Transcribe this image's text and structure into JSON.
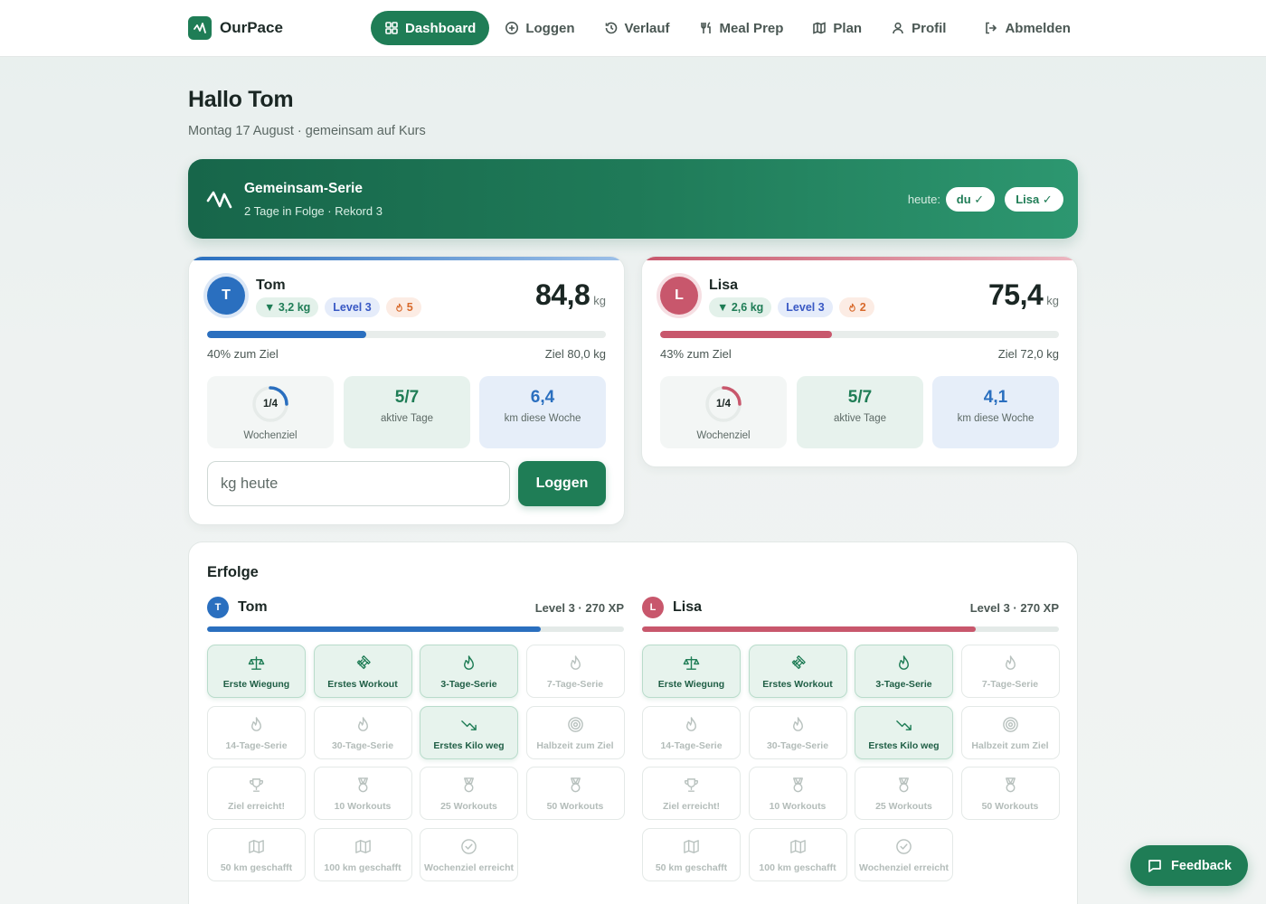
{
  "app": {
    "name": "OurPace"
  },
  "nav": {
    "items": [
      {
        "label": "Dashboard",
        "icon": "grid-icon",
        "active": true
      },
      {
        "label": "Loggen",
        "icon": "plus-circle-icon"
      },
      {
        "label": "Verlauf",
        "icon": "history-icon"
      },
      {
        "label": "Meal Prep",
        "icon": "fork-knife-icon"
      },
      {
        "label": "Plan",
        "icon": "map-icon"
      },
      {
        "label": "Profil",
        "icon": "user-icon"
      },
      {
        "label": "Abmelden",
        "icon": "logout-icon"
      }
    ]
  },
  "header": {
    "greeting": "Hallo Tom",
    "subline": "Montag 17 August · gemeinsam auf Kurs"
  },
  "streak": {
    "title": "Gemeinsam-Serie",
    "subtitle": "2 Tage in Folge · Rekord 3",
    "today_label": "heute:",
    "pill_you": "du ✓",
    "pill_partner": "Lisa ✓"
  },
  "people": [
    {
      "initial": "T",
      "name": "Tom",
      "color": "#2a6fbf",
      "ring_bg": "#dbe7f6",
      "loss": "▼ 3,2 kg",
      "level": "Level 3",
      "streak": "5",
      "weight": "84,8",
      "unit": "kg",
      "progress_pct": 40,
      "progress_label": "40% zum Ziel",
      "goal_label": "Ziel 80,0 kg",
      "week_goal": "1/4",
      "week_goal_fraction": 0.25,
      "week_goal_label": "Wochenziel",
      "active_days": "5/7",
      "active_days_label": "aktive Tage",
      "km": "6,4",
      "km_label": "km diese Woche",
      "input_placeholder": "kg heute",
      "log_button": "Loggen"
    },
    {
      "initial": "L",
      "name": "Lisa",
      "color": "#c8576c",
      "ring_bg": "#f6dfe3",
      "loss": "▼ 2,6 kg",
      "level": "Level 3",
      "streak": "2",
      "weight": "75,4",
      "unit": "kg",
      "progress_pct": 43,
      "progress_label": "43% zum Ziel",
      "goal_label": "Ziel 72,0 kg",
      "week_goal": "1/4",
      "week_goal_fraction": 0.25,
      "week_goal_label": "Wochenziel",
      "active_days": "5/7",
      "active_days_label": "aktive Tage",
      "km": "4,1",
      "km_label": "km diese Woche"
    }
  ],
  "achievements": {
    "title": "Erfolge",
    "players": [
      {
        "initial": "T",
        "name": "Tom",
        "level_xp": "Level 3 · 270 XP",
        "xp_pct": 80,
        "color": "#2a6fbf"
      },
      {
        "initial": "L",
        "name": "Lisa",
        "level_xp": "Level 3 · 270 XP",
        "xp_pct": 80,
        "color": "#c8576c"
      }
    ],
    "items": [
      {
        "label": "Erste Wiegung",
        "icon": "scale-icon",
        "unlocked": true
      },
      {
        "label": "Erstes Workout",
        "icon": "dumbbell-icon",
        "unlocked": true
      },
      {
        "label": "3-Tage-Serie",
        "icon": "flame-icon",
        "unlocked": true
      },
      {
        "label": "7-Tage-Serie",
        "icon": "flame-icon",
        "unlocked": false
      },
      {
        "label": "14-Tage-Serie",
        "icon": "flame-icon",
        "unlocked": false
      },
      {
        "label": "30-Tage-Serie",
        "icon": "flame-icon",
        "unlocked": false
      },
      {
        "label": "Erstes Kilo weg",
        "icon": "trend-down-icon",
        "unlocked": true
      },
      {
        "label": "Halbzeit zum Ziel",
        "icon": "target-icon",
        "unlocked": false
      },
      {
        "label": "Ziel erreicht!",
        "icon": "trophy-icon",
        "unlocked": false
      },
      {
        "label": "10 Workouts",
        "icon": "medal-icon",
        "unlocked": false
      },
      {
        "label": "25 Workouts",
        "icon": "medal-icon",
        "unlocked": false
      },
      {
        "label": "50 Workouts",
        "icon": "medal-icon",
        "unlocked": false
      },
      {
        "label": "50 km geschafft",
        "icon": "map-icon",
        "unlocked": false
      },
      {
        "label": "100 km geschafft",
        "icon": "map-icon",
        "unlocked": false
      },
      {
        "label": "Wochenziel erreicht",
        "icon": "check-circle-icon",
        "unlocked": false
      }
    ]
  },
  "feedback": {
    "label": "Feedback"
  },
  "colors": {
    "brand": "#1f7d56",
    "tom": "#2a6fbf",
    "lisa": "#c8576c"
  }
}
